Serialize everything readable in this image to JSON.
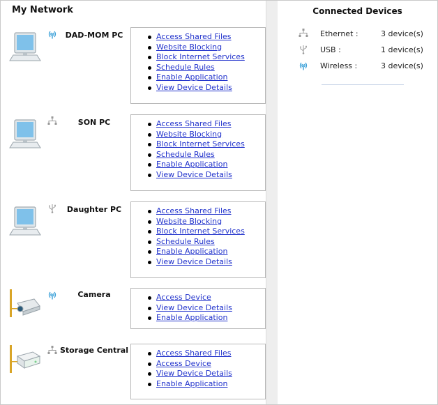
{
  "left": {
    "title": "My Network"
  },
  "devices": [
    {
      "name": "DAD-MOM PC",
      "type": "pc",
      "connection": "wireless",
      "links": [
        "Access Shared Files",
        "Website Blocking",
        "Block Internet Services",
        "Schedule Rules",
        "Enable Application",
        "View Device Details"
      ]
    },
    {
      "name": "SON PC",
      "type": "pc",
      "connection": "ethernet",
      "links": [
        "Access Shared Files",
        "Website Blocking",
        "Block Internet Services",
        "Schedule Rules",
        "Enable Application",
        "View Device Details"
      ]
    },
    {
      "name": "Daughter PC",
      "type": "pc",
      "connection": "usb",
      "links": [
        "Access Shared Files",
        "Website Blocking",
        "Block Internet Services",
        "Schedule Rules",
        "Enable Application",
        "View Device Details"
      ]
    },
    {
      "name": "Camera",
      "type": "camera",
      "connection": "wireless",
      "links": [
        "Access Device",
        "View Device Details",
        "Enable Application"
      ]
    },
    {
      "name": "Storage Central",
      "type": "storage",
      "connection": "ethernet",
      "links": [
        "Access Shared Files",
        "Access Device",
        "View Device Details",
        "Enable Application"
      ]
    }
  ],
  "right": {
    "title": "Connected Devices",
    "rows": [
      {
        "icon": "ethernet-icon",
        "label": "Ethernet :",
        "value": "3 device(s)"
      },
      {
        "icon": "usb-icon",
        "label": "USB :",
        "value": "1 device(s)"
      },
      {
        "icon": "wireless-icon",
        "label": "Wireless :",
        "value": "3 device(s)"
      }
    ]
  },
  "colors": {
    "link": "#2233cc",
    "wireless": "#3aa0d8",
    "panel_bg": "#eeeeee"
  }
}
